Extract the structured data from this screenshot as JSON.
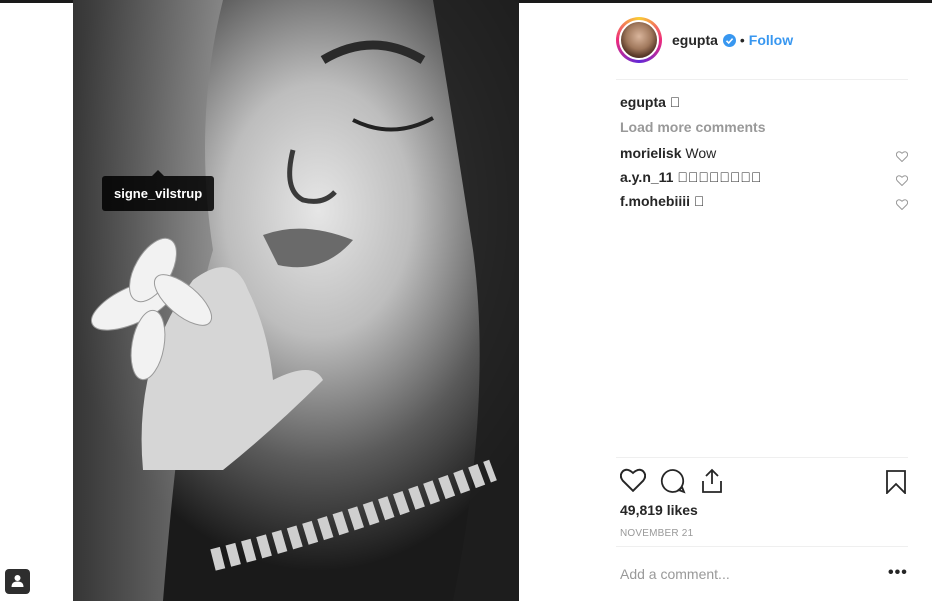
{
  "post": {
    "tagged_user": "signe_vilstrup"
  },
  "header": {
    "username": "egupta",
    "separator": "•",
    "follow_label": "Follow"
  },
  "caption": {
    "username": "egupta",
    "text": "􏿽"
  },
  "comments": {
    "load_more_label": "Load more comments",
    "items": [
      {
        "username": "morielisk",
        "text": "Wow"
      },
      {
        "username": "a.y.n_11",
        "text": "􏿽􏿽􏿽􏿽􏿽􏿽􏿽􏿽"
      },
      {
        "username": "f.mohebiiii",
        "text": "􏿽"
      }
    ]
  },
  "stats": {
    "likes": "49,819 likes",
    "date": "NOVEMBER 21"
  },
  "composer": {
    "placeholder": "Add a comment...",
    "more_label": "•••"
  },
  "icons": {
    "verified": "verified-badge-icon",
    "like": "heart-icon",
    "comment": "comment-bubble-icon",
    "share": "share-icon",
    "save": "bookmark-icon",
    "user_tag": "user-tag-icon"
  },
  "colors": {
    "accent": "#3897f0",
    "muted": "#999999",
    "text": "#262626"
  }
}
